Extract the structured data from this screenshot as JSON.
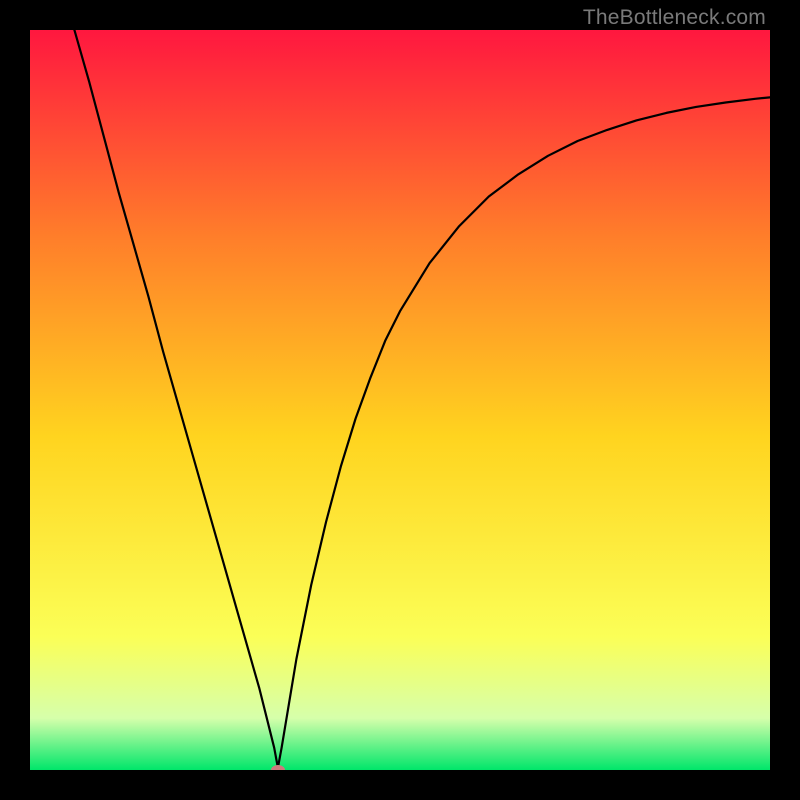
{
  "watermark": "TheBottleneck.com",
  "chart_data": {
    "type": "line",
    "title": "",
    "xlabel": "",
    "ylabel": "",
    "xlim": [
      0,
      100
    ],
    "ylim": [
      0,
      100
    ],
    "grid": false,
    "legend": false,
    "gradient_colors": {
      "top": "#ff173f",
      "upper_mid": "#ff7e2a",
      "mid": "#ffd41f",
      "lower_mid": "#fbff57",
      "lower": "#d6ffab",
      "bottom": "#00e66a"
    },
    "optimum_marker": {
      "x": 33.5,
      "y": 0,
      "color": "#cd7a7d"
    },
    "series": [
      {
        "name": "bottleneck-curve",
        "x": [
          6,
          8,
          10,
          12,
          14,
          16,
          18,
          20,
          22,
          24,
          26,
          28,
          30,
          31,
          32,
          33,
          33.5,
          34,
          35,
          36,
          38,
          40,
          42,
          44,
          46,
          48,
          50,
          54,
          58,
          62,
          66,
          70,
          74,
          78,
          82,
          86,
          90,
          94,
          98,
          100
        ],
        "y": [
          100,
          93,
          85.5,
          78,
          71,
          64,
          56.5,
          49.5,
          42.5,
          35.5,
          28.5,
          21.5,
          14.5,
          11,
          7,
          3,
          0.3,
          3,
          9,
          15,
          25,
          33.5,
          41,
          47.5,
          53,
          58,
          62,
          68.5,
          73.5,
          77.5,
          80.5,
          83,
          85,
          86.5,
          87.8,
          88.8,
          89.6,
          90.2,
          90.7,
          90.9
        ]
      }
    ]
  }
}
